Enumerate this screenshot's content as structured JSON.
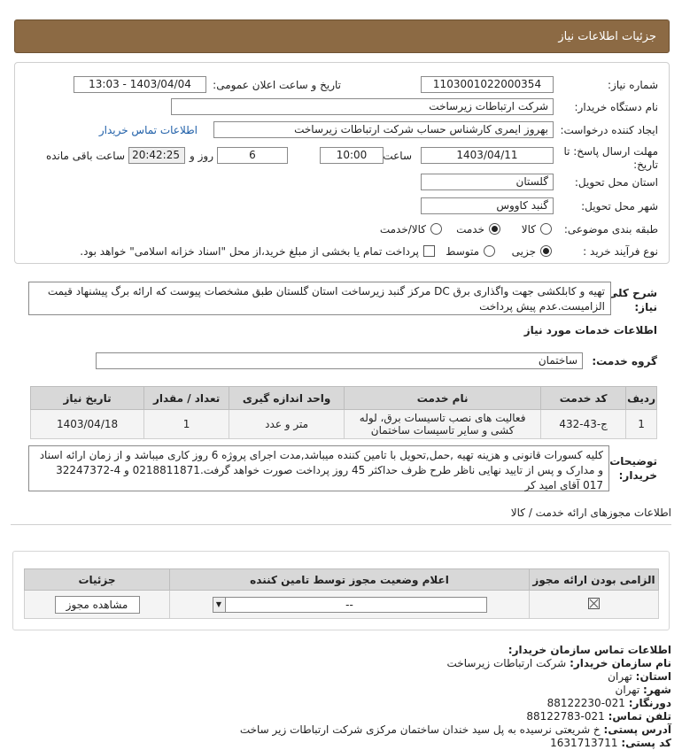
{
  "header": {
    "title": "جزئیات اطلاعات نیاز"
  },
  "fields": {
    "need_number_label": "شماره نیاز:",
    "need_number": "1103001022000354",
    "announce_label": "تاریخ و ساعت اعلان عمومی:",
    "announce_value": "1403/04/04 - 13:03",
    "buyer_org_label": "نام دستگاه خریدار:",
    "buyer_org": "شرکت ارتباطات زیرساخت",
    "creator_label": "ایجاد کننده درخواست:",
    "creator": "بهروز ایمری کارشناس حساب شرکت ارتباطات زیرساخت",
    "contact_link": "اطلاعات تماس خریدار",
    "deadline_label_1": "مهلت ارسال پاسخ: تا",
    "deadline_label_2": "تاریخ:",
    "deadline_date": "1403/04/11",
    "time_label": "ساعت",
    "deadline_time": "10:00",
    "days_value": "6",
    "days_label": "روز و",
    "remaining_time": "20:42:25",
    "remaining_label": "ساعت باقی مانده",
    "province_label": "استان محل تحویل:",
    "province": "گلستان",
    "city_label": "شهر محل تحویل:",
    "city": "گنبد کاووس",
    "category_label": "طبقه بندی موضوعی:",
    "category_options": [
      "کالا",
      "خدمت",
      "کالا/خدمت"
    ],
    "purchase_label": "نوع فرآیند خرید :",
    "purchase_options": [
      "جزیی",
      "متوسط"
    ],
    "purchase_note": "پرداخت تمام یا بخشی از مبلغ خرید،از محل \"اسناد خزانه اسلامی\" خواهد بود."
  },
  "summary": {
    "label_1": "شرح کلی",
    "label_2": "نیاز:",
    "text": "تهیه و کابلکشی جهت واگذاری برق DC مرکز گنبد زیرساخت استان گلستان طبق مشخصات پیوست که ارائه برگ پیشنهاد قیمت الزامیست.عدم پیش پرداخت"
  },
  "services": {
    "section_title": "اطلاعات خدمات مورد نیاز",
    "group_label": "گروه خدمت:",
    "group_value": "ساختمان",
    "columns": [
      "ردیف",
      "کد خدمت",
      "نام خدمت",
      "واحد اندازه گیری",
      "تعداد / مقدار",
      "تاریخ نیاز"
    ],
    "rows": [
      {
        "row": "1",
        "code": "ج-43-432",
        "name": "فعالیت های نصب تاسیسات برق، لوله کشی و سایر تاسیسات ساختمان",
        "unit": "متر و عدد",
        "qty": "1",
        "date": "1403/04/18"
      }
    ]
  },
  "buyer_notes": {
    "label_1": "توضیحات",
    "label_2": "خریدار:",
    "text": "کلیه کسورات قانونی و هزینه تهیه ,حمل,تحویل با تامین کننده میباشد,مدت اجرای پروژه 6 روز کاری میباشد و از زمان ارائه اسناد و مدارک و پس از تایید نهایی ناظر طرح ظرف حداکثر 45 روز پرداخت صورت خواهد گرفت.0218811871 و 4-32247372 017 آقای امید کر"
  },
  "licenses": {
    "section_title": "اطلاعات مجوزهای ارائه خدمت / کالا",
    "columns": [
      "الزامی بودن ارائه مجوز",
      "اعلام وضعیت مجوز توسط تامین کننده",
      "جزئیات"
    ],
    "status_value": "--",
    "view_button": "مشاهده مجوز"
  },
  "contact": {
    "title": "اطلاعات تماس سازمان خریدار:",
    "org_label": "نام سازمان خریدار:",
    "org": "شرکت ارتباطات زیرساخت",
    "province_label": "استان:",
    "province": "تهران",
    "city_label": "شهر:",
    "city": "تهران",
    "fax_label": "دورنگار:",
    "fax": "021-88122230",
    "phone_label": "تلفن تماس:",
    "phone": "021-88122783",
    "address_label": "آدرس پستی:",
    "address": "خ شریعتی نرسیده به پل سید خندان ساختمان مرکزی شرکت ارتباطات زیر ساخت",
    "postal_label": "کد پستی:",
    "postal": "1631713711"
  }
}
